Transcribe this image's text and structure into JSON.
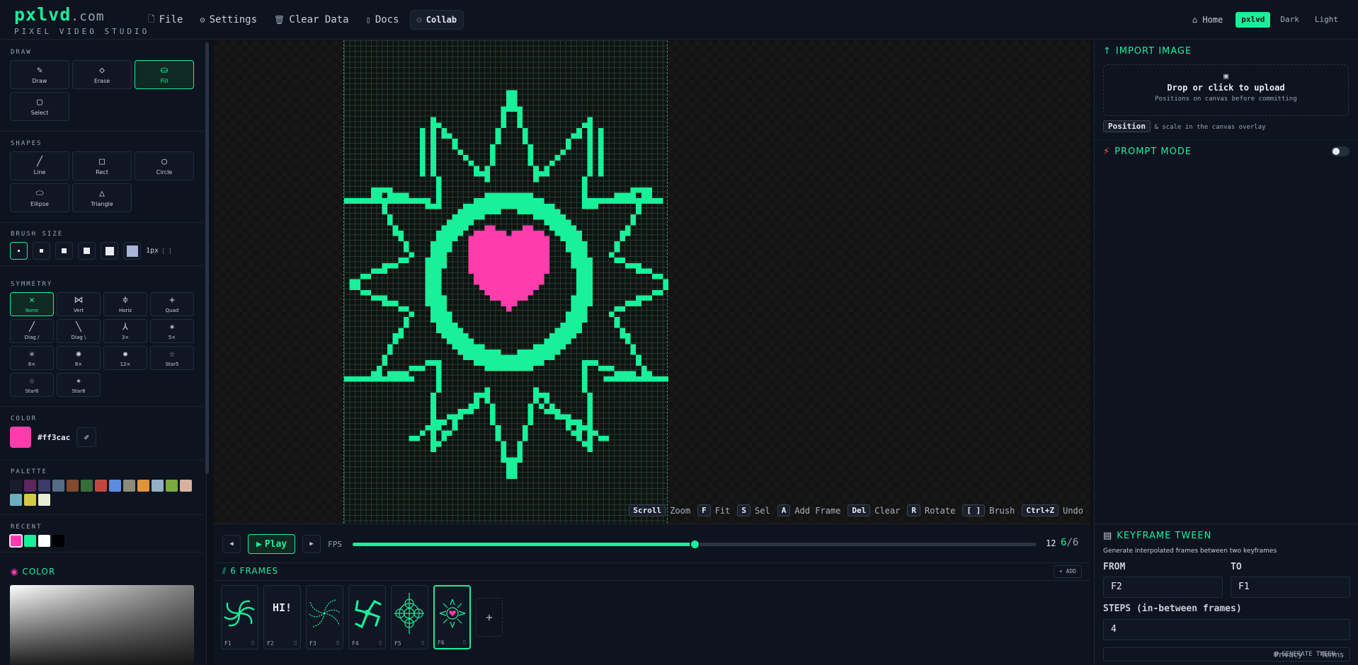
{
  "app": {
    "name": "pxlvd",
    "domain": ".com",
    "subtitle": "PIXEL VIDEO STUDIO"
  },
  "nav": [
    {
      "label": "File",
      "icon": "file-icon"
    },
    {
      "label": "Settings",
      "icon": "settings-icon"
    },
    {
      "label": "Clear Data",
      "icon": "trash-icon"
    },
    {
      "label": "Docs",
      "icon": "docs-icon"
    },
    {
      "label": "Collab",
      "icon": "users-icon"
    }
  ],
  "topright": {
    "home": "Home",
    "themes": [
      "pxlvd",
      "Dark",
      "Light"
    ]
  },
  "left": {
    "draw_title": "DRAW",
    "draw_tools": [
      "Draw",
      "Erase",
      "Fill",
      "Select"
    ],
    "shapes_title": "SHAPES",
    "shapes": [
      "Line",
      "Rect",
      "Circle",
      "Ellipse",
      "Triangle"
    ],
    "brush_title": "BRUSH SIZE",
    "brush_readout": "1px",
    "brush_keys": "[ ]",
    "symmetry_title": "SYMMETRY",
    "symmetry": [
      "None",
      "Vert",
      "Horiz",
      "Quad",
      "Diag /",
      "Diag \\",
      "3×",
      "5×",
      "6×",
      "8×",
      "12×",
      "Star5",
      "Star6",
      "Star8"
    ],
    "color_title": "COLOR",
    "color_hex": "#ff3cac",
    "palette_title": "PALETTE",
    "palette": [
      "#1a1c2c",
      "#5d275d",
      "#3b3b6b",
      "#566c86",
      "#814a2c",
      "#386c3a",
      "#c0473f",
      "#5a8de0",
      "#8b8b79",
      "#e0943a",
      "#94b0c2",
      "#7aab3c",
      "#d7b29e",
      "#6cb0c0",
      "#d4c94a",
      "#e8ecd6"
    ],
    "recent_title": "RECENT",
    "recent": [
      "#ff3cac",
      "#18f09a",
      "#ffffff",
      "#000000"
    ],
    "picker_title": "COLOR"
  },
  "hints": [
    {
      "k": "Scroll",
      "t": "Zoom"
    },
    {
      "k": "F",
      "t": "Fit"
    },
    {
      "k": "S",
      "t": "Sel"
    },
    {
      "k": "A",
      "t": "Add Frame"
    },
    {
      "k": "Del",
      "t": "Clear"
    },
    {
      "k": "R",
      "t": "Rotate"
    },
    {
      "k": "[ ]",
      "t": "Brush"
    },
    {
      "k": "Ctrl+Z",
      "t": "Undo"
    }
  ],
  "timeline": {
    "play": "Play",
    "fps_label": "FPS",
    "fps": 12,
    "fps_max": 24,
    "current": "6",
    "total": "/6",
    "frames_title": "6 FRAMES",
    "add": "+ ADD",
    "frames": [
      "F1",
      "F2",
      "F3",
      "F4",
      "F5",
      "F6"
    ],
    "f2_text": "HI!"
  },
  "right": {
    "import_title": "IMPORT IMAGE",
    "drop_main": "Drop or click to upload",
    "drop_sub": "Positions on canvas before committing",
    "position_chip": "Position",
    "position_text": "& scale in the canvas overlay",
    "prompt_title": "PROMPT MODE",
    "tween_title": "KEYFRAME TWEEN",
    "tween_desc": "Generate interpolated frames between two keyframes",
    "from_label": "FROM",
    "to_label": "TO",
    "from": "F2",
    "to": "F1",
    "steps_label": "STEPS (in-between frames)",
    "steps": "4",
    "generate": "GENERATE TWEEN",
    "privacy": "Privacy",
    "terms": "Terms"
  },
  "colors": {
    "accent": "#18f09a",
    "pink": "#ff3cac",
    "bg": "#0c1019"
  }
}
